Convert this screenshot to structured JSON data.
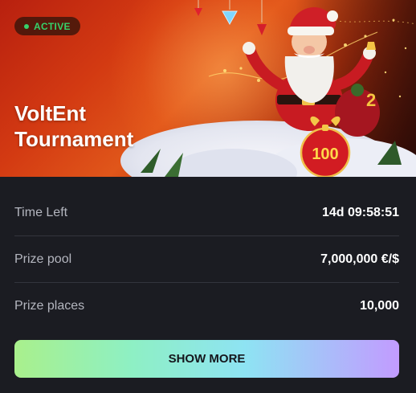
{
  "banner": {
    "status": "ACTIVE",
    "title_line1": "VoltEnt",
    "title_line2": "Tournament",
    "gift_number": "100",
    "colors": {
      "status_green": "#36d16b",
      "banner_red": "#d33a12"
    }
  },
  "info": {
    "rows": [
      {
        "label": "Time Left",
        "value": "14d 09:58:51"
      },
      {
        "label": "Prize pool",
        "value": "7,000,000 €/$"
      },
      {
        "label": "Prize places",
        "value": "10,000"
      }
    ]
  },
  "actions": {
    "show_more_label": "SHOW MORE"
  }
}
